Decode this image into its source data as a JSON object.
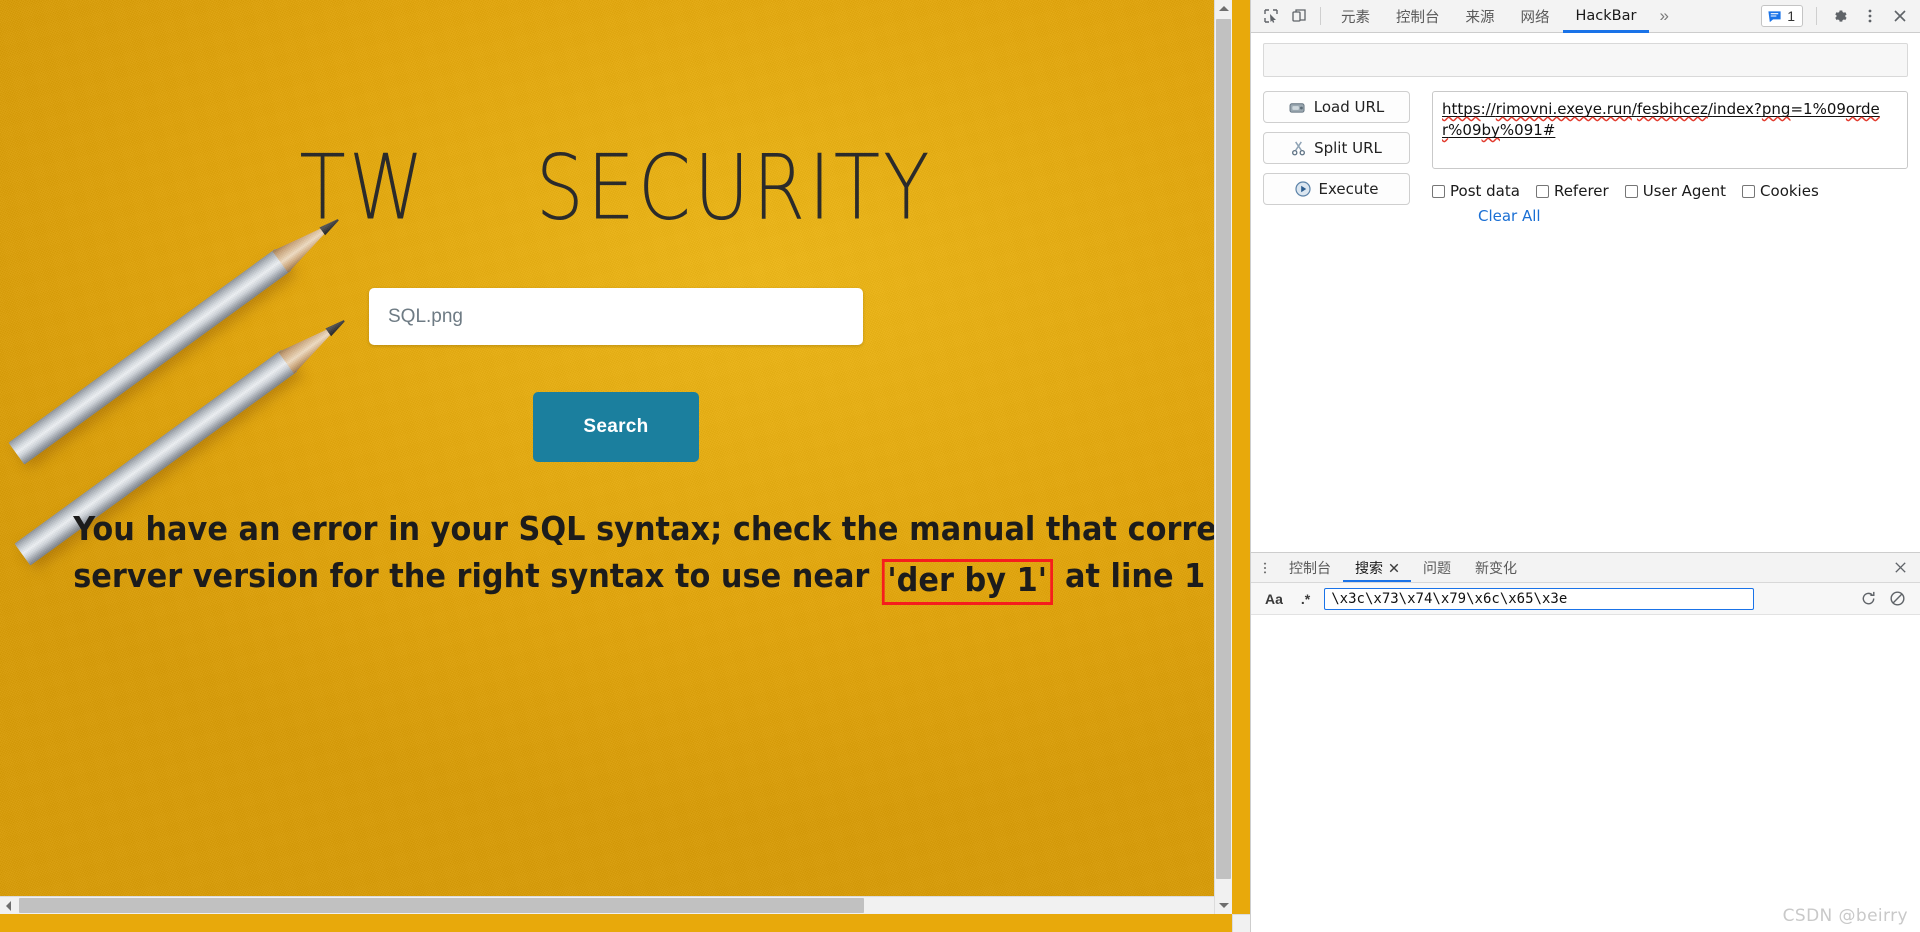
{
  "page": {
    "title": "TW    SECURITY",
    "search": {
      "placeholder": "SQL.png",
      "value": ""
    },
    "search_button_label": "Search",
    "error": {
      "line1": "You have an error in your SQL syntax; check the manual that corresponds to yo",
      "line2_before": "server version for the right syntax to use near",
      "line2_highlight": "'der by 1'",
      "line2_after": "at line 1"
    },
    "accent_background": "#e3a60a",
    "button_color": "#1b7f9e",
    "highlight_box_color": "#f61d1d"
  },
  "devtools": {
    "toolbar": {
      "inspect_icon": "inspect-element-icon",
      "device_icon": "device-toolbar-icon",
      "tabs": [
        {
          "label": "元素",
          "active": false
        },
        {
          "label": "控制台",
          "active": false
        },
        {
          "label": "来源",
          "active": false
        },
        {
          "label": "网络",
          "active": false
        },
        {
          "label": "HackBar",
          "active": true
        }
      ],
      "more_tabs_label": "»",
      "issues_count": "1",
      "issues_icon": "message-icon",
      "settings_icon": "gear-icon",
      "kebab_icon": "more-options-icon",
      "close_icon": "close-icon"
    },
    "hackbar": {
      "buttons": [
        {
          "label": "Load URL",
          "icon": "load-url-icon"
        },
        {
          "label": "Split URL",
          "icon": "split-url-icon"
        },
        {
          "label": "Execute",
          "icon": "execute-icon"
        }
      ],
      "url_value": "https://rimovni.exeye.run/fesbihcez/index?png=1%09order%09by%091#",
      "url_parts": {
        "scheme": "https",
        "sep1": "://",
        "host": "rimovni.exeye.run",
        "slash1": "/",
        "path1": "fesbihcez",
        "slash2": "/",
        "path2": "index?",
        "query_key": "png",
        "query_rest": "=1%09",
        "kw1": "order",
        "pct1": "%09",
        "kw2": "by",
        "tail": "%091#"
      },
      "options": [
        {
          "label": "Post data",
          "checked": false
        },
        {
          "label": "Referer",
          "checked": false
        },
        {
          "label": "User Agent",
          "checked": false
        },
        {
          "label": "Cookies",
          "checked": false
        }
      ],
      "clear_all_label": "Clear All"
    },
    "drawer": {
      "kebab_icon": "more-options-icon",
      "tabs": [
        {
          "label": "控制台",
          "active": false,
          "closable": false
        },
        {
          "label": "搜索",
          "active": true,
          "closable": true
        },
        {
          "label": "问题",
          "active": false,
          "closable": false
        },
        {
          "label": "新变化",
          "active": false,
          "closable": false
        }
      ],
      "close_icon": "close-icon",
      "search": {
        "match_case_label": "Aa",
        "regex_label": ".*",
        "value": "\\x3c\\x73\\x74\\x79\\x6c\\x65\\x3e",
        "placeholder": "",
        "refresh_icon": "refresh-icon",
        "clear_icon": "clear-icon"
      }
    }
  },
  "watermark": "CSDN @beirry"
}
